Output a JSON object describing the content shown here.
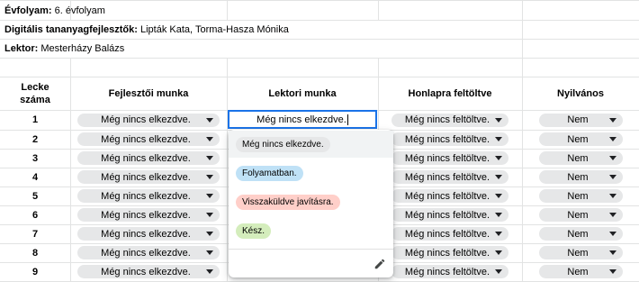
{
  "info_rows": [
    {
      "label": "Évfolyam:",
      "value": " 6. évfolyam"
    },
    {
      "label": "Digitális tananyagfejlesztők:",
      "value": " Lipták Kata, Torma-Hasza Mónika"
    },
    {
      "label": "Lektor:",
      "value": " Mesterházy Balázs"
    }
  ],
  "headers": {
    "lecke_line1": "Lecke",
    "lecke_line2": "száma",
    "fejlesztoi": "Fejlesztői munka",
    "lektori": "Lektori munka",
    "honlapra": "Honlapra feltöltve",
    "nyilvanos": "Nyilvános"
  },
  "rows": [
    {
      "num": "1",
      "fejlesztoi": "Még nincs elkezdve.",
      "honlapra": "Még nincs feltöltve.",
      "nyilvanos": "Nem"
    },
    {
      "num": "2",
      "fejlesztoi": "Még nincs elkezdve.",
      "honlapra": "Még nincs feltöltve.",
      "nyilvanos": "Nem"
    },
    {
      "num": "3",
      "fejlesztoi": "Még nincs elkezdve.",
      "honlapra": "Még nincs feltöltve.",
      "nyilvanos": "Nem"
    },
    {
      "num": "4",
      "fejlesztoi": "Még nincs elkezdve.",
      "honlapra": "Még nincs feltöltve.",
      "nyilvanos": "Nem"
    },
    {
      "num": "5",
      "fejlesztoi": "Még nincs elkezdve.",
      "honlapra": "Még nincs feltöltve.",
      "nyilvanos": "Nem"
    },
    {
      "num": "6",
      "fejlesztoi": "Még nincs elkezdve.",
      "honlapra": "Még nincs feltöltve.",
      "nyilvanos": "Nem"
    },
    {
      "num": "7",
      "fejlesztoi": "Még nincs elkezdve.",
      "honlapra": "Még nincs feltöltve.",
      "nyilvanos": "Nem"
    },
    {
      "num": "8",
      "fejlesztoi": "Még nincs elkezdve.",
      "honlapra": "Még nincs feltöltve.",
      "nyilvanos": "Nem"
    },
    {
      "num": "9",
      "fejlesztoi": "Még nincs elkezdve.",
      "honlapra": "Még nincs feltöltve.",
      "nyilvanos": "Nem"
    }
  ],
  "editing_cell": {
    "value": "Még nincs elkezdve."
  },
  "dropdown": {
    "options": [
      {
        "label": "Még nincs elkezdve.",
        "color": "#e6e7e8",
        "selected": true
      },
      {
        "label": "Folyamatban.",
        "color": "#bfe1f6",
        "selected": false
      },
      {
        "label": "Visszaküldve javításra.",
        "color": "#ffcfc9",
        "selected": false
      },
      {
        "label": "Kész.",
        "color": "#d4edbc",
        "selected": false
      }
    ],
    "edit_icon": "pencil-icon"
  }
}
